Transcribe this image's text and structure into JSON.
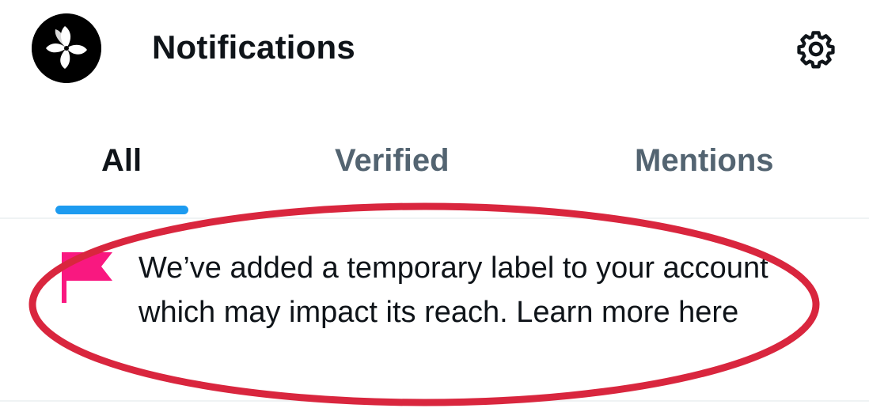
{
  "header": {
    "title": "Notifications",
    "avatar_icon": "bauhinia-flag-icon",
    "settings_icon": "gear-icon"
  },
  "tabs": [
    {
      "label": "All",
      "active": true
    },
    {
      "label": "Verified",
      "active": false
    },
    {
      "label": "Mentions",
      "active": false
    }
  ],
  "notification": {
    "icon": "flag-icon",
    "icon_color": "#f91880",
    "text": "We’ve added a temporary label to your account which may impact its reach. Learn more here"
  },
  "colors": {
    "accent": "#1d9bf0",
    "annotation": "#d9263e",
    "text_primary": "#0f1419",
    "text_secondary": "#536471"
  }
}
